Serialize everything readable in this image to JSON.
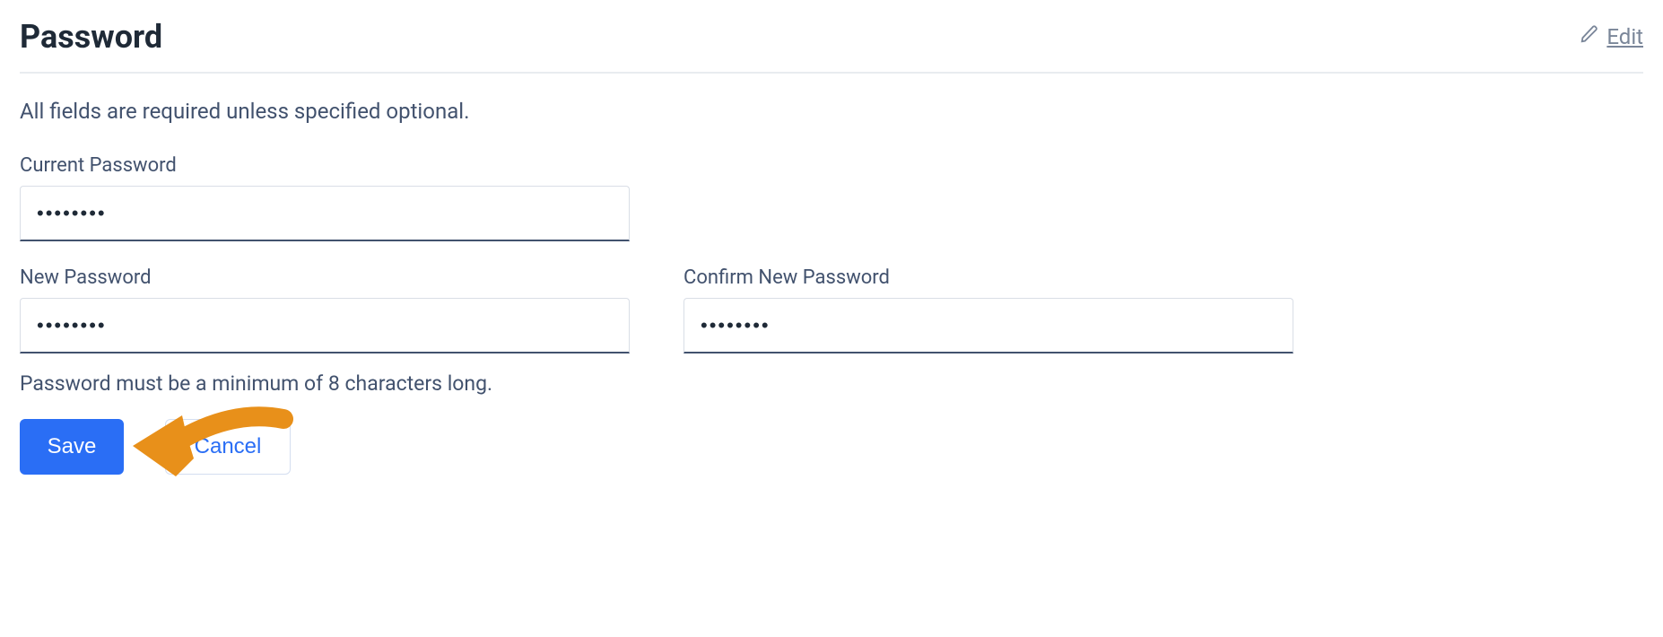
{
  "header": {
    "title": "Password",
    "edit_label": "Edit"
  },
  "form": {
    "instruction": "All fields are required unless specified optional.",
    "current_password": {
      "label": "Current Password",
      "value": "••••••••"
    },
    "new_password": {
      "label": "New Password",
      "value": "••••••••",
      "helper": "Password must be a minimum of 8 characters long."
    },
    "confirm_password": {
      "label": "Confirm New Password",
      "value": "••••••••"
    }
  },
  "actions": {
    "save_label": "Save",
    "cancel_label": "Cancel"
  },
  "annotation": {
    "arrow_color": "#e8901a"
  }
}
